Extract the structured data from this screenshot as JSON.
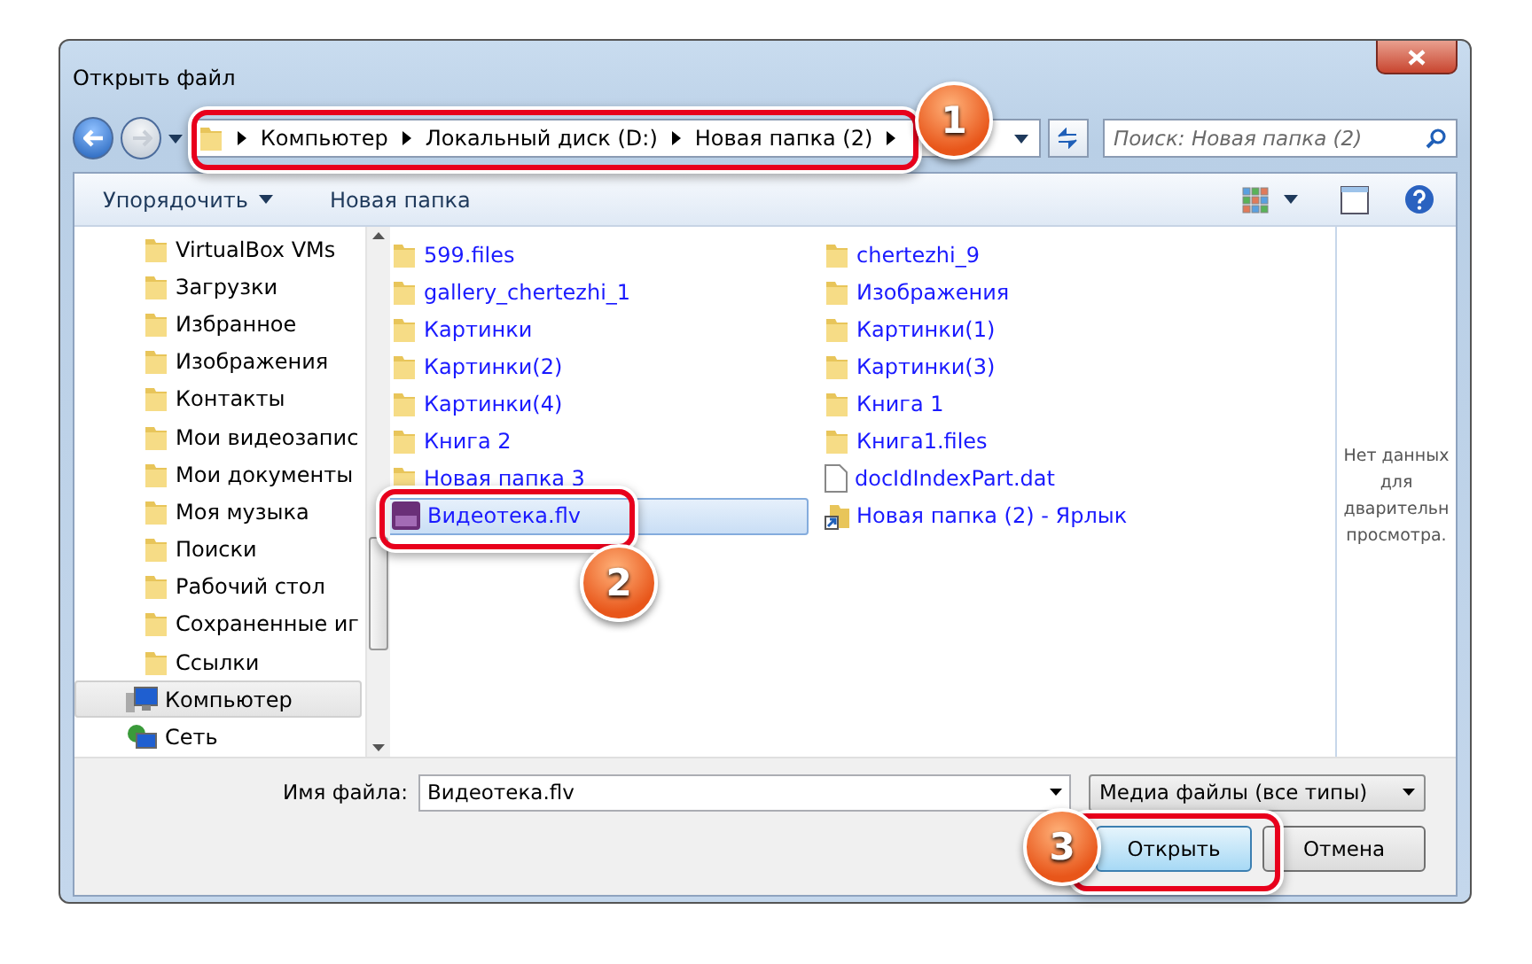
{
  "window": {
    "title": "Открыть файл"
  },
  "address": {
    "crumbs": [
      "Компьютер",
      "Локальный диск (D:)",
      "Новая папка (2)"
    ]
  },
  "search": {
    "placeholder": "Поиск: Новая папка (2)"
  },
  "toolbar": {
    "organize": "Упорядочить",
    "new_folder": "Новая папка"
  },
  "sidebar": {
    "items": [
      {
        "label": "VirtualBox VMs",
        "kind": "folder",
        "selected": false
      },
      {
        "label": "Загрузки",
        "kind": "folder",
        "selected": false
      },
      {
        "label": "Избранное",
        "kind": "folder",
        "selected": false
      },
      {
        "label": "Изображения",
        "kind": "folder",
        "selected": false
      },
      {
        "label": "Контакты",
        "kind": "folder",
        "selected": false
      },
      {
        "label": "Мои видеозапис",
        "kind": "folder",
        "selected": false
      },
      {
        "label": "Мои документы",
        "kind": "folder",
        "selected": false
      },
      {
        "label": "Моя музыка",
        "kind": "folder",
        "selected": false
      },
      {
        "label": "Поиски",
        "kind": "folder",
        "selected": false
      },
      {
        "label": "Рабочий стол",
        "kind": "folder",
        "selected": false
      },
      {
        "label": "Сохраненные иг",
        "kind": "folder",
        "selected": false
      },
      {
        "label": "Ссылки",
        "kind": "folder",
        "selected": false
      },
      {
        "label": "Компьютер",
        "kind": "computer",
        "selected": true
      },
      {
        "label": "Сеть",
        "kind": "network",
        "selected": false
      }
    ]
  },
  "files": [
    {
      "name": "599.files",
      "kind": "folder",
      "selected": false
    },
    {
      "name": "gallery_chertezhi_1",
      "kind": "folder",
      "selected": false
    },
    {
      "name": "Картинки",
      "kind": "folder",
      "selected": false
    },
    {
      "name": "Картинки(2)",
      "kind": "folder",
      "selected": false
    },
    {
      "name": "Картинки(4)",
      "kind": "folder",
      "selected": false
    },
    {
      "name": "Книга 2",
      "kind": "folder",
      "selected": false
    },
    {
      "name": "Новая папка 3",
      "kind": "folder",
      "selected": false
    },
    {
      "name": "Видеотека.flv",
      "kind": "video",
      "selected": true
    },
    {
      "name": "chertezhi_9",
      "kind": "folder",
      "selected": false
    },
    {
      "name": "Изображения",
      "kind": "folder",
      "selected": false
    },
    {
      "name": "Картинки(1)",
      "kind": "folder",
      "selected": false
    },
    {
      "name": "Картинки(3)",
      "kind": "folder",
      "selected": false
    },
    {
      "name": "Книга 1",
      "kind": "folder",
      "selected": false
    },
    {
      "name": "Книга1.files",
      "kind": "folder",
      "selected": false
    },
    {
      "name": "docIdIndexPart.dat",
      "kind": "document",
      "selected": false
    },
    {
      "name": "Новая папка (2) - Ярлык",
      "kind": "shortcut",
      "selected": false
    }
  ],
  "preview": {
    "lines": [
      "Нет данных",
      "для",
      "дварительн",
      "просмотра."
    ]
  },
  "filename": {
    "label": "Имя файла:",
    "value": "Видеотека.flv"
  },
  "filetype": {
    "value": "Медиа файлы (все типы)"
  },
  "buttons": [
    {
      "label": "Открыть",
      "kind": "primary"
    },
    {
      "label": "Отмена",
      "kind": "normal"
    }
  ],
  "callouts": [
    {
      "number": "1"
    },
    {
      "number": "2"
    },
    {
      "number": "3"
    }
  ]
}
